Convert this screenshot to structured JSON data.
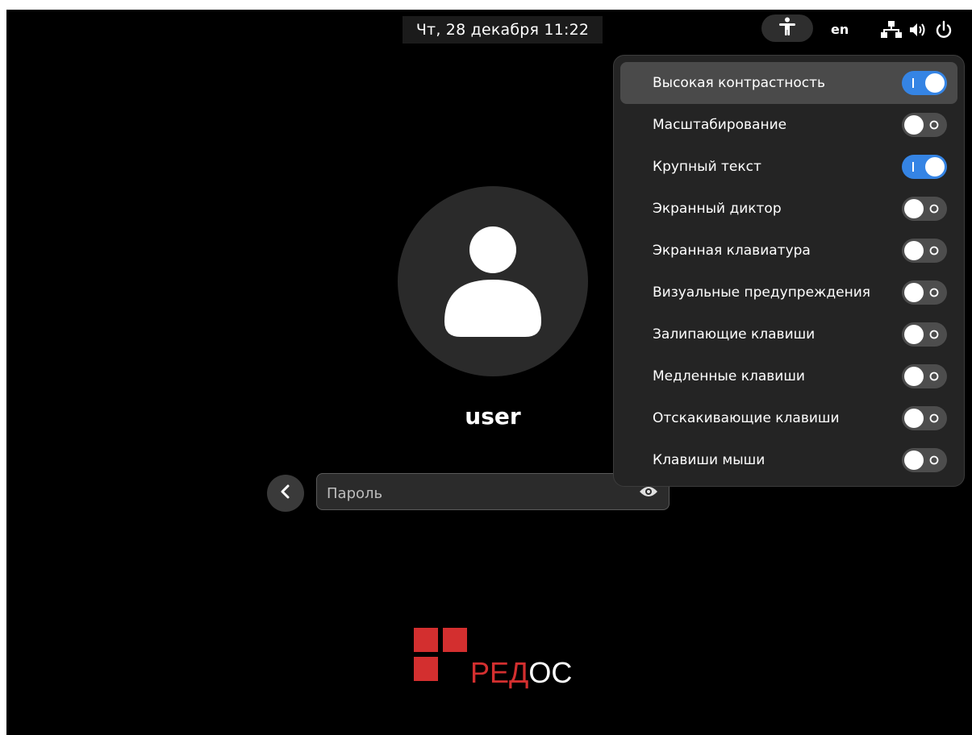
{
  "top_bar": {
    "clock": "Чт, 28 декабря  11:22",
    "language": "en",
    "icons": [
      "accessibility-icon",
      "network-icon",
      "volume-icon",
      "power-icon"
    ]
  },
  "login": {
    "username": "user",
    "password_placeholder": "Пароль",
    "icons": [
      "avatar-icon",
      "back-icon",
      "show-password-icon"
    ]
  },
  "logo": {
    "text_red": "РЕД",
    "text_white": "ОС",
    "color": "#d32f2f"
  },
  "accessibility_menu": {
    "items": [
      {
        "label": "Высокая контрастность",
        "enabled": true
      },
      {
        "label": "Масштабирование",
        "enabled": false
      },
      {
        "label": "Крупный текст",
        "enabled": true
      },
      {
        "label": "Экранный диктор",
        "enabled": false
      },
      {
        "label": "Экранная клавиатура",
        "enabled": false
      },
      {
        "label": "Визуальные предупреждения",
        "enabled": false
      },
      {
        "label": "Залипающие клавиши",
        "enabled": false
      },
      {
        "label": "Медленные клавиши",
        "enabled": false
      },
      {
        "label": "Отскакивающие клавиши",
        "enabled": false
      },
      {
        "label": "Клавиши мыши",
        "enabled": false
      }
    ],
    "highlighted_index": 0
  },
  "colors": {
    "background": "#000000",
    "menu_background": "#242424",
    "toggle_on": "#3584e4",
    "toggle_off": "#4d4d4d"
  }
}
